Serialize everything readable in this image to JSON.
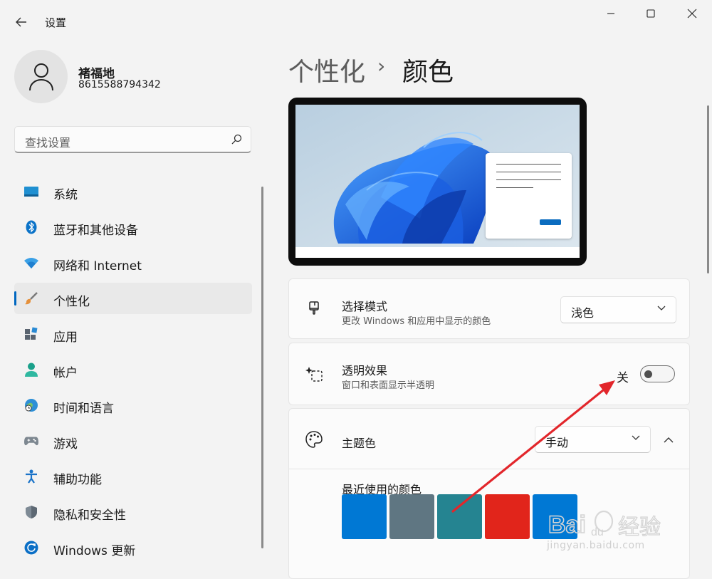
{
  "window": {
    "app_title": "设置",
    "controls": [
      "minimize-icon",
      "maximize-icon",
      "close-icon"
    ]
  },
  "user": {
    "name": "褚福地",
    "account": "8615588794342"
  },
  "search": {
    "placeholder": "查找设置"
  },
  "sidebar": {
    "items": [
      {
        "label": "系统",
        "icon": "system-icon",
        "active": false
      },
      {
        "label": "蓝牙和其他设备",
        "icon": "bluetooth-icon",
        "active": false
      },
      {
        "label": "网络和 Internet",
        "icon": "wifi-icon",
        "active": false
      },
      {
        "label": "个性化",
        "icon": "brush-icon",
        "active": true
      },
      {
        "label": "应用",
        "icon": "apps-icon",
        "active": false
      },
      {
        "label": "帐户",
        "icon": "account-icon",
        "active": false
      },
      {
        "label": "时间和语言",
        "icon": "globe-clock-icon",
        "active": false
      },
      {
        "label": "游戏",
        "icon": "gamepad-icon",
        "active": false
      },
      {
        "label": "辅助功能",
        "icon": "accessibility-icon",
        "active": false
      },
      {
        "label": "隐私和安全性",
        "icon": "shield-icon",
        "active": false
      },
      {
        "label": "Windows 更新",
        "icon": "update-icon",
        "active": false
      }
    ]
  },
  "breadcrumb": {
    "parent": "个性化",
    "separator": "›",
    "current": "颜色"
  },
  "mode_card": {
    "title": "选择模式",
    "subtitle": "更改 Windows 和应用中显示的颜色",
    "selected": "浅色",
    "icon": "paintbrush-icon"
  },
  "transparency_card": {
    "title": "透明效果",
    "subtitle": "窗口和表面显示半透明",
    "state_label": "关",
    "enabled": false,
    "icon": "transparency-icon"
  },
  "accent_card": {
    "title": "主题色",
    "selected": "手动",
    "expanded": true,
    "recent_label": "最近使用的颜色",
    "recent_colors": [
      "#0078d4",
      "#5f7682",
      "#258491",
      "#e1251b",
      "#0078d4"
    ],
    "icon": "palette-icon"
  },
  "colors": {
    "accent": "#0067c0",
    "annotation_arrow": "#e2262b"
  },
  "watermark": {
    "logo_text": "Bai du 经验",
    "url": "jingyan.baidu.com"
  }
}
